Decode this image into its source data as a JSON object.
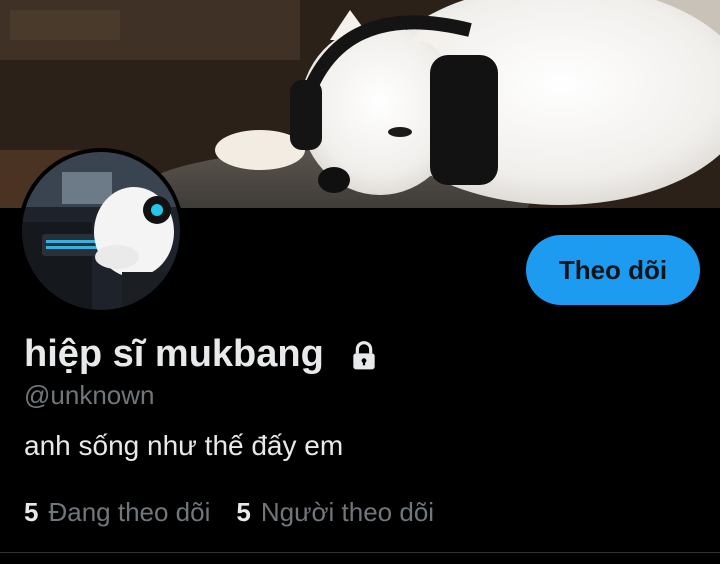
{
  "profile": {
    "display_name": "hiệp sĩ mukbang",
    "handle": "@unknown",
    "bio": "anh sống như thế đấy em",
    "locked_icon": "lock-icon",
    "follow_label": "Theo dõi"
  },
  "stats": {
    "following_count": "5",
    "following_label": "Đang theo dõi",
    "followers_count": "5",
    "followers_label": "Người theo dõi"
  },
  "colors": {
    "accent": "#1d9bf0",
    "background": "#000000",
    "muted_text": "#71767b"
  }
}
